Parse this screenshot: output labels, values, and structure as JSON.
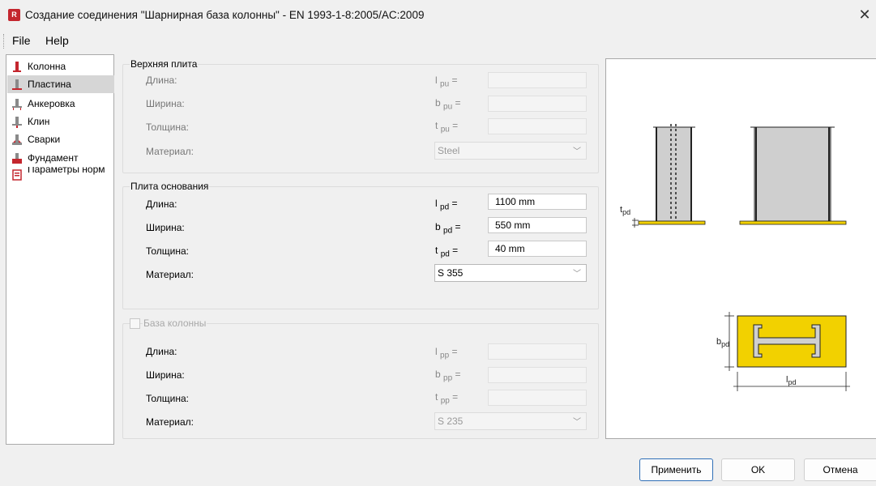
{
  "window": {
    "app_icon_letter": "R",
    "title": "Создание соединения \"Шарнирная база колонны\" - EN 1993-1-8:2005/AC:2009",
    "close_glyph": "✕"
  },
  "menu": {
    "file": "File",
    "help": "Help"
  },
  "sidebar": {
    "items": [
      {
        "label": "Колонна",
        "selected": false
      },
      {
        "label": "Пластина",
        "selected": true
      },
      {
        "label": "Анкеровка",
        "selected": false
      },
      {
        "label": "Клин",
        "selected": false
      },
      {
        "label": "Сварки",
        "selected": false
      },
      {
        "label": "Фундамент",
        "selected": false
      },
      {
        "label": "Параметры норм",
        "selected": false
      }
    ]
  },
  "top_plate": {
    "title": "Верхняя плита",
    "length_label": "Длина:",
    "length_sym": "l",
    "length_sub": "pu",
    "width_label": "Ширина:",
    "width_sym": "b",
    "width_sub": "pu",
    "thickness_label": "Толщина:",
    "thickness_sym": "t",
    "thickness_sub": "pu",
    "material_label": "Материал:",
    "material_value": "Steel",
    "eq": "="
  },
  "base_plate": {
    "title": "Плита основания",
    "length_label": "Длина:",
    "length_sym": "l",
    "length_sub": "pd",
    "length_value": "1100 mm",
    "width_label": "Ширина:",
    "width_sym": "b",
    "width_sub": "pd",
    "width_value": "550 mm",
    "thickness_label": "Толщина:",
    "thickness_sym": "t",
    "thickness_sub": "pd",
    "thickness_value": "40 mm",
    "material_label": "Материал:",
    "material_value": "S 355",
    "eq": "="
  },
  "column_base": {
    "title": "База колонны",
    "checked": false,
    "length_label": "Длина:",
    "length_sym": "l",
    "length_sub": "pp",
    "width_label": "Ширина:",
    "width_sym": "b",
    "width_sub": "pp",
    "thickness_label": "Толщина:",
    "thickness_sym": "t",
    "thickness_sub": "pp",
    "material_label": "Материал:",
    "material_value": "S 235",
    "eq": "="
  },
  "preview": {
    "t_label": "t",
    "t_sub": "pd",
    "b_label": "b",
    "b_sub": "pd",
    "l_label": "l",
    "l_sub": "pd"
  },
  "buttons": {
    "apply": "Применить",
    "ok": "OK",
    "cancel": "Отмена"
  },
  "colors": {
    "accent": "#2f6fb7",
    "plate": "#f2d100",
    "icon_red": "#c4262e",
    "selected_bg": "#d6d6d6"
  },
  "icons": [
    "column-icon",
    "plate-icon",
    "anchor-icon",
    "wedge-icon",
    "weld-icon",
    "foundation-icon",
    "code-params-icon",
    "chevron-down-icon",
    "close-icon"
  ]
}
